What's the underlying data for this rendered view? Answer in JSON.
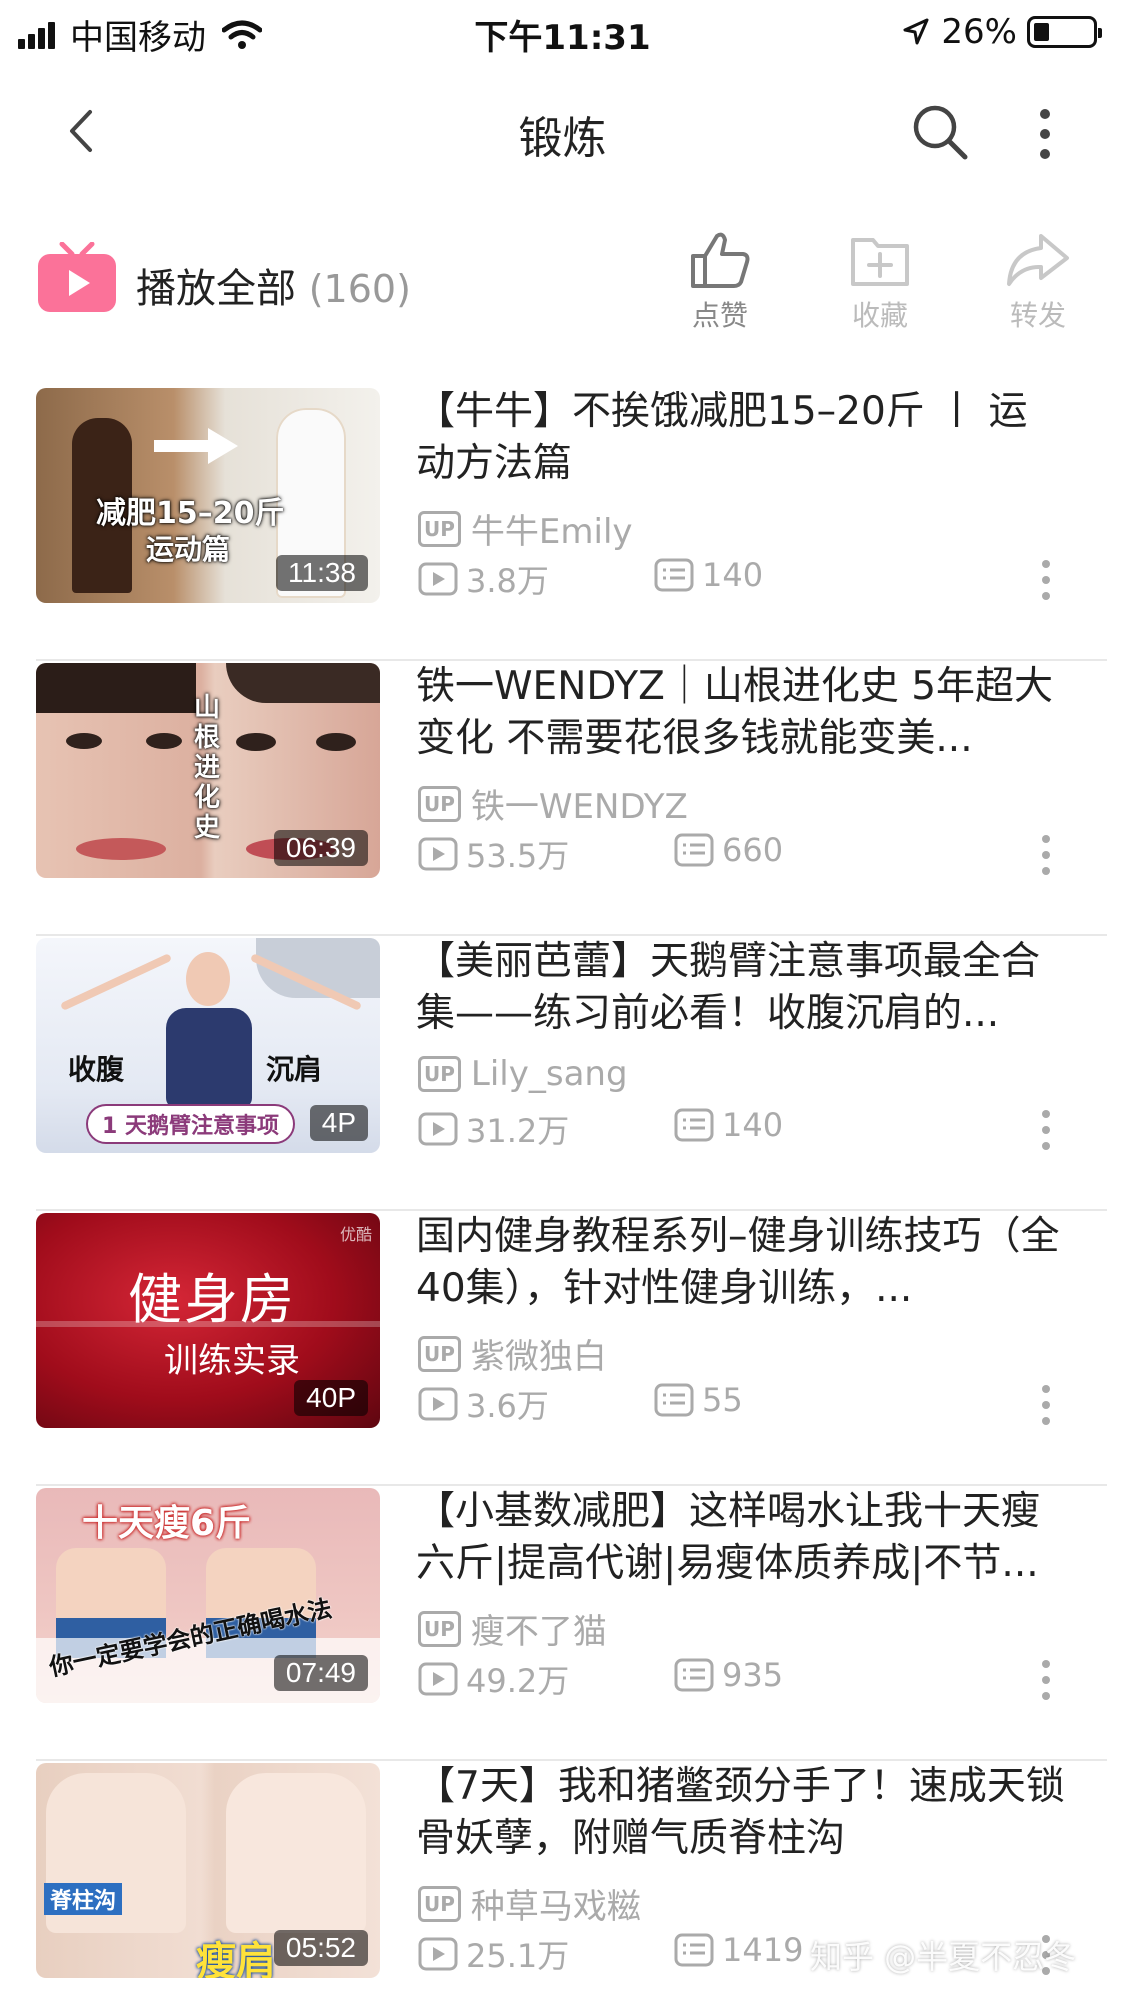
{
  "status_bar": {
    "carrier": "中国移动",
    "time": "下午11:31",
    "battery_percent": "26%",
    "battery_level": 0.26
  },
  "nav": {
    "title": "锻炼",
    "icons": [
      "back-arrow-icon",
      "search-icon",
      "more-vertical-icon"
    ]
  },
  "play_all": {
    "label": "播放全部",
    "count": "(160)",
    "actions": {
      "like": "点赞",
      "favorite": "收藏",
      "share": "转发"
    }
  },
  "videos": [
    {
      "title": "【牛牛】不挨饿减肥15–20斤 丨 运动方法篇",
      "uploader": "牛牛Emily",
      "plays": "3.8万",
      "danmaku": "140",
      "duration": "11:38",
      "thumb_text": [
        "减肥15–20斤",
        "运动篇"
      ],
      "thumb_colors": [
        "#8d6a4a",
        "#c9a888",
        "#e6e1d8"
      ]
    },
    {
      "title": "铁一WENDYZ｜山根进化史 5年超大变化 不需要花很多钱就能变美...",
      "uploader": "铁一WENDYZ",
      "plays": "53.5万",
      "danmaku": "660",
      "duration": "06:39",
      "thumb_text": [
        "山根进化史"
      ],
      "thumb_colors": [
        "#e7c3b3",
        "#d7a697",
        "#3a2a24"
      ]
    },
    {
      "title": "【美丽芭蕾】天鹅臂注意事项最全合集——练习前必看！收腹沉肩的...",
      "uploader": "Lily_sang",
      "plays": "31.2万",
      "danmaku": "140",
      "duration": "4P",
      "thumb_text": [
        "收腹",
        "沉肩",
        "1 天鹅臂注意事项"
      ],
      "thumb_colors": [
        "#eef1f8",
        "#d4dbe9",
        "#2c3a6e"
      ]
    },
    {
      "title": "国内健身教程系列–健身训练技巧（全40集），针对性健身训练，...",
      "uploader": "紫微独白",
      "plays": "3.6万",
      "danmaku": "55",
      "duration": "40P",
      "thumb_text": [
        "健身房",
        "训练实录",
        "优酷"
      ],
      "thumb_colors": [
        "#b0101f",
        "#6e0710",
        "#d42636"
      ]
    },
    {
      "title": "【小基数减肥】这样喝水让我十天瘦六斤|提高代谢|易瘦体质养成|不节...",
      "uploader": "瘦不了猫",
      "plays": "49.2万",
      "danmaku": "935",
      "duration": "07:49",
      "thumb_text": [
        "十天瘦6斤",
        "你一定要学会的正确喝水法"
      ],
      "thumb_colors": [
        "#e9b9b9",
        "#f2d6cf",
        "#2f5fa2"
      ]
    },
    {
      "title": "【7天】我和猪鳖颈分手了！速成天锁骨妖孽，附赠气质脊柱沟",
      "uploader": "种草马戏糍",
      "plays": "25.1万",
      "danmaku": "1419",
      "duration": "05:52",
      "thumb_text": [
        "脊柱沟",
        "瘦肩"
      ],
      "thumb_colors": [
        "#e8cfc0",
        "#f1ddd2",
        "#2d6fc1"
      ]
    }
  ],
  "watermark": "知乎 @半夏不忍冬"
}
